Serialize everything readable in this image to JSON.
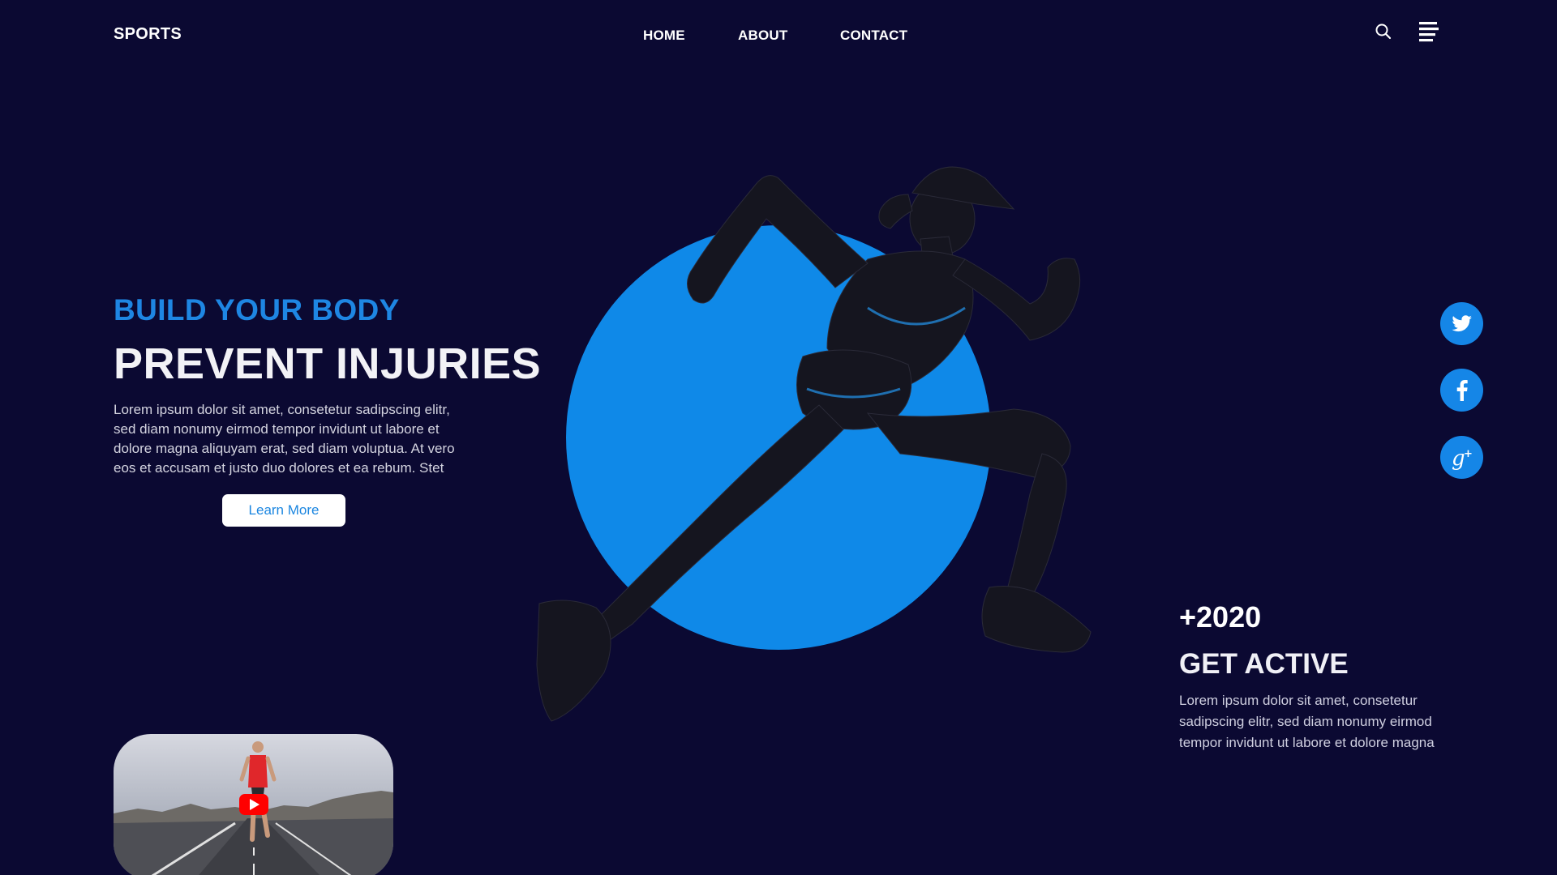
{
  "header": {
    "logo": "SPORTS",
    "nav": [
      "HOME",
      "ABOUT",
      "CONTACT"
    ]
  },
  "hero": {
    "kicker": "BUILD YOUR BODY",
    "headline": "PREVENT INJURIES",
    "lead": "Lorem ipsum dolor sit amet, consetetur sadipscing elitr, sed diam nonumy eirmod tempor invidunt ut labore et dolore magna aliquyam erat, sed diam voluptua. At vero eos et accusam et justo duo dolores et ea rebum. Stet",
    "button_label": "Learn More"
  },
  "social": [
    "twitter-icon",
    "facebook-icon",
    "google-plus-icon"
  ],
  "stats": {
    "number": "+2020",
    "title": "GET ACTIVE",
    "text": "Lorem ipsum dolor sit amet, consetetur sadipscing elitr, sed diam nonumy eirmod tempor invidunt ut labore et dolore magna"
  },
  "colors": {
    "background": "#0b0932",
    "accent": "#0f89e8",
    "video_play": "#ff0000"
  }
}
